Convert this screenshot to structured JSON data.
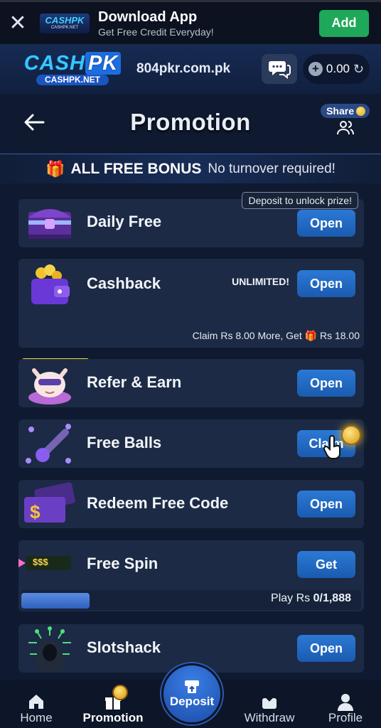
{
  "download_bar": {
    "close": "✕",
    "logo_line1": "CASHPK",
    "logo_line2": "CASHPK.NET",
    "title": "Download App",
    "subtitle": "Get Free Credit Everyday!",
    "add_label": "Add"
  },
  "header": {
    "brand_left": "CASH",
    "brand_right": "PK",
    "brand_sub": "CASHPK.NET",
    "domain": "804pkr.com.pk",
    "balance": "0.00"
  },
  "title_row": {
    "title": "Promotion",
    "share_label": "Share"
  },
  "bonus_strip": {
    "bold": "ALL FREE BONUS",
    "light": "No turnover required!"
  },
  "cards": {
    "daily_free": {
      "label": "Daily Free",
      "button": "Open",
      "tag": "Deposit to unlock prize!"
    },
    "cashback": {
      "label": "Cashback",
      "button": "Open",
      "unlimited": "UNLIMITED!",
      "claim_prefix": "Claim Rs 8.00 More, Get",
      "claim_reward": "Rs 18.00",
      "progress": 0.2
    },
    "refer": {
      "label": "Refer & Earn",
      "button": "Open"
    },
    "free_balls": {
      "label": "Free Balls",
      "button": "Claim"
    },
    "redeem": {
      "label": "Redeem Free Code",
      "button": "Open"
    },
    "free_spin": {
      "label": "Free Spin",
      "button": "Get",
      "thumb_text": "$$$",
      "play_prefix": "Play Rs",
      "play_value": "0/1,888",
      "progress": 0.2
    },
    "slotshack": {
      "label": "Slotshack",
      "button": "Open"
    }
  },
  "nav": {
    "home": "Home",
    "promotion": "Promotion",
    "deposit": "Deposit",
    "withdraw": "Withdraw",
    "profile": "Profile"
  },
  "colors": {
    "background": "#0f1a30",
    "card": "#1c2a45",
    "button_blue": "#2b79d6",
    "add_green": "#1fa85a",
    "gold": "#f4e13e"
  }
}
